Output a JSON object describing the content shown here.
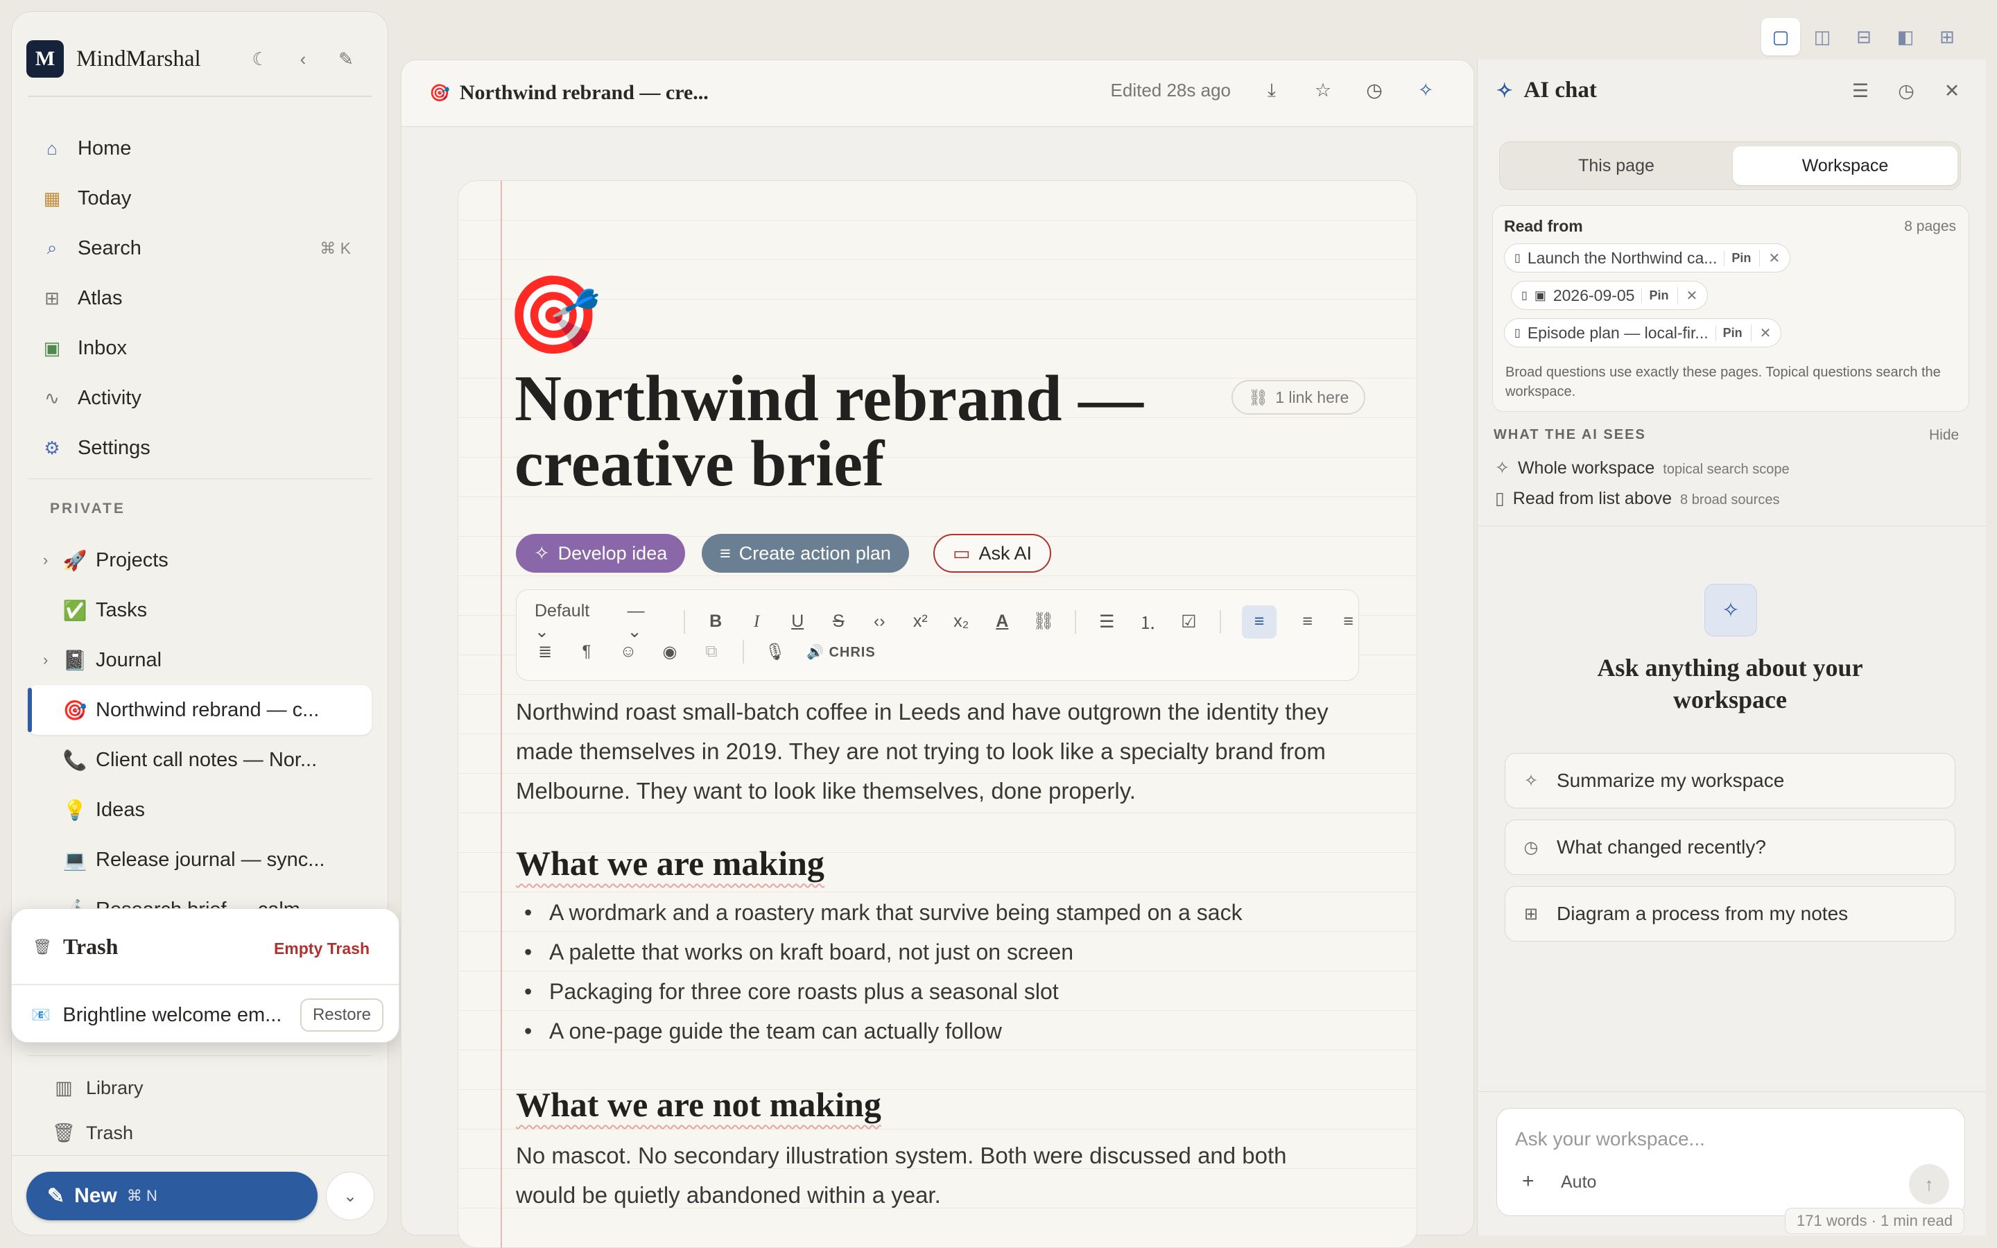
{
  "app": {
    "name": "MindMarshal",
    "logo_text": "M"
  },
  "sidebar": {
    "nav": [
      {
        "label": "Home",
        "icon": "home-icon"
      },
      {
        "label": "Today",
        "icon": "calendar-icon"
      },
      {
        "label": "Search",
        "icon": "search-icon",
        "shortcut": "⌘ K"
      },
      {
        "label": "Atlas",
        "icon": "grid-icon"
      },
      {
        "label": "Inbox",
        "icon": "inbox-icon"
      },
      {
        "label": "Activity",
        "icon": "pulse-icon"
      },
      {
        "label": "Settings",
        "icon": "gear-icon"
      }
    ],
    "section_label": "PRIVATE",
    "tree": [
      {
        "label": "Projects",
        "emoji": "🚀",
        "has_children": true
      },
      {
        "label": "Tasks",
        "emoji": "✅",
        "has_children": false
      },
      {
        "label": "Journal",
        "emoji": "📓",
        "has_children": true
      },
      {
        "label": "Northwind rebrand — c...",
        "emoji": "🎯",
        "active": true
      },
      {
        "label": "Client call notes — Nor...",
        "emoji": "📞"
      },
      {
        "label": "Ideas",
        "emoji": "💡"
      },
      {
        "label": "Release journal — sync...",
        "emoji": "💻"
      },
      {
        "label": "Research brief — calm...",
        "emoji": "🔬"
      }
    ],
    "bottom": [
      {
        "label": "Library",
        "icon": "library-icon"
      },
      {
        "label": "Trash",
        "icon": "trash-icon"
      }
    ],
    "new_button": {
      "label": "New",
      "shortcut": "⌘ N"
    }
  },
  "trash_popup": {
    "title": "Trash",
    "empty_label": "Empty Trash",
    "item": {
      "label": "Brightline welcome em...",
      "emoji": "📧",
      "restore_label": "Restore"
    }
  },
  "doc": {
    "header_title": "Northwind rebrand — cre...",
    "edited": "Edited 28s ago",
    "emoji": "🎯",
    "title_line1": "Northwind rebrand —",
    "title_line2": "creative brief",
    "link_here": "1 link here",
    "actions": {
      "develop": "Develop idea",
      "plan": "Create action plan",
      "ask": "Ask AI"
    },
    "toolbar": {
      "style": "Default",
      "dash": "—",
      "tts": "CHRIS"
    },
    "intro_line1": "Northwind roast small-batch coffee in Leeds and have outgrown the identity they",
    "intro_line2": "made themselves in 2019. They are not trying to look like a specialty brand from",
    "intro_line3": "Melbourne. They want to look like themselves, done properly.",
    "h2_making": "What we are making",
    "making": [
      "A wordmark and a roastery mark that survive being stamped on a sack",
      "A palette that works on kraft board, not just on screen",
      "Packaging for three core roasts plus a seasonal slot",
      "A one-page guide the team can actually follow"
    ],
    "h2_not": "What we are not making",
    "not_line1": "No mascot. No secondary illustration system. Both were discussed and both",
    "not_line2": "would be quietly abandoned within a year."
  },
  "ai": {
    "title": "AI chat",
    "tabs": [
      "This page",
      "Workspace"
    ],
    "active_tab": "Workspace",
    "read_from": "Read from",
    "page_count": "8 pages",
    "chips": [
      {
        "label": "Launch the Northwind ca...",
        "icon": "doc-icon"
      },
      {
        "label": "2026-09-05",
        "icon": "journal-icon"
      },
      {
        "label": "Episode plan — local-fir...",
        "icon": "doc-icon"
      }
    ],
    "pin_label": "Pin",
    "note": "Broad questions use exactly these pages. Topical questions search the workspace.",
    "sees_label": "WHAT THE AI SEES",
    "hide_label": "Hide",
    "sees": [
      {
        "label": "Whole workspace",
        "sub": "topical search scope"
      },
      {
        "label": "Read from list above",
        "sub": "8 broad sources"
      }
    ],
    "ask_title": "Ask anything about your workspace",
    "suggestions": [
      {
        "label": "Summarize my workspace",
        "icon": "sparkle-icon"
      },
      {
        "label": "What changed recently?",
        "icon": "clock-icon"
      },
      {
        "label": "Diagram a process from my notes",
        "icon": "grid-icon"
      }
    ],
    "input_placeholder": "Ask your workspace...",
    "mode": "Auto",
    "word_count": "171 words · 1 min read"
  },
  "colors": {
    "accent": "#2c5ba0",
    "develop": "#8a67a9",
    "plan": "#6b7f93",
    "ask_border": "#b0322e"
  }
}
